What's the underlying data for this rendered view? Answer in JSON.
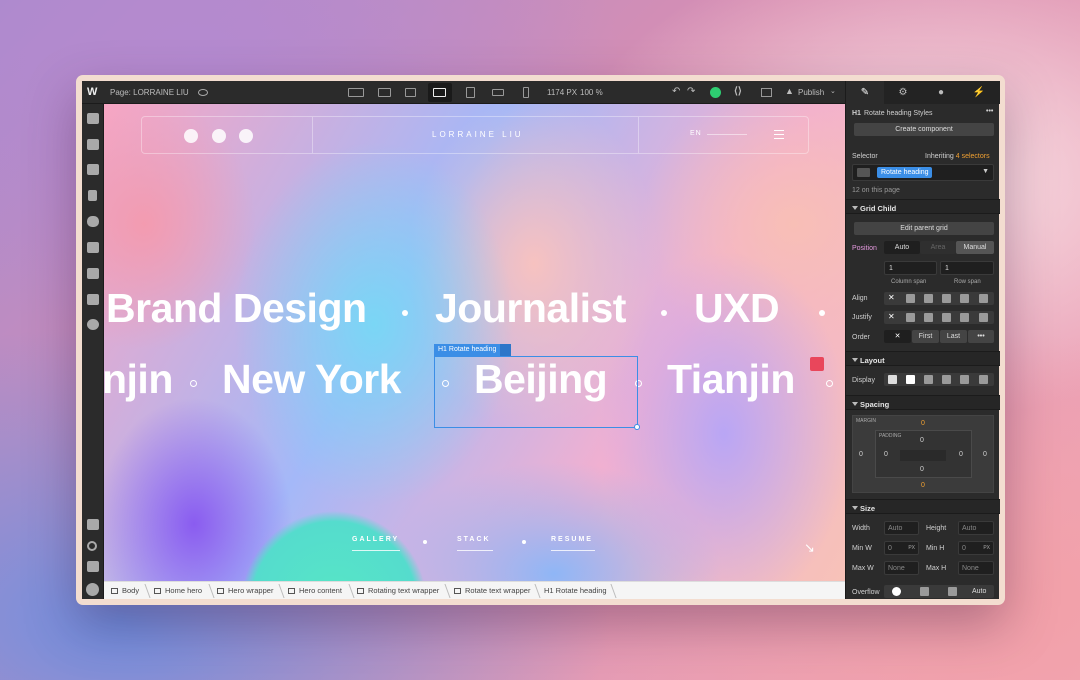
{
  "topbar": {
    "logo": "W",
    "page": "Page: LORRAINE LIU",
    "width": "1174 PX",
    "zoom": "100 %",
    "publish": "Publish"
  },
  "nav": {
    "brand": "LORRAINE LIU",
    "lang": "EN"
  },
  "hero": {
    "row1": [
      "Brand Design",
      "Journalist",
      "UXD"
    ],
    "row2": [
      "njin",
      "New York",
      "Beijing",
      "Tianjin"
    ]
  },
  "selection": {
    "label": "Rotate heading"
  },
  "bottom_nav": [
    "GALLERY",
    "STACK",
    "RESUME"
  ],
  "breadcrumbs": [
    "Body",
    "Home hero",
    "Hero wrapper",
    "Hero content",
    "Rotating text wrapper",
    "Rotate text wrapper",
    "Rotate heading"
  ],
  "panel": {
    "header": "Rotate heading Styles",
    "create": "Create component",
    "selector_label": "Selector",
    "inheriting": "Inheriting",
    "inheriting_count": "4 selectors",
    "selector_tag": "Rotate heading",
    "count_text": "12 on this page",
    "grid_child": "Grid Child",
    "edit_parent": "Edit parent grid",
    "position": "Position",
    "pos_opts": [
      "Auto",
      "Area",
      "Manual"
    ],
    "col_val": "1",
    "row_val": "1",
    "col_span": "Column span",
    "row_span": "Row span",
    "align": "Align",
    "justify": "Justify",
    "order": "Order",
    "order_first": "First",
    "order_last": "Last",
    "layout": "Layout",
    "display": "Display",
    "spacing": "Spacing",
    "margin": "MARGIN",
    "padding": "PADDING",
    "mt": "0",
    "mr": "0",
    "mb": "0",
    "ml": "0",
    "pt": "0",
    "pr": "0",
    "pb": "0",
    "pl": "0",
    "size": "Size",
    "width": "Width",
    "height": "Height",
    "auto": "Auto",
    "minw": "Min W",
    "minh": "Min H",
    "zero": "0",
    "px": "PX",
    "maxw": "Max W",
    "maxh": "Max H",
    "none": "None",
    "overflow": "Overflow",
    "overflow_auto": "Auto"
  },
  "colors": {
    "accent": "#3b8ee6",
    "orange": "#f0a032",
    "green": "#2ecc71"
  }
}
